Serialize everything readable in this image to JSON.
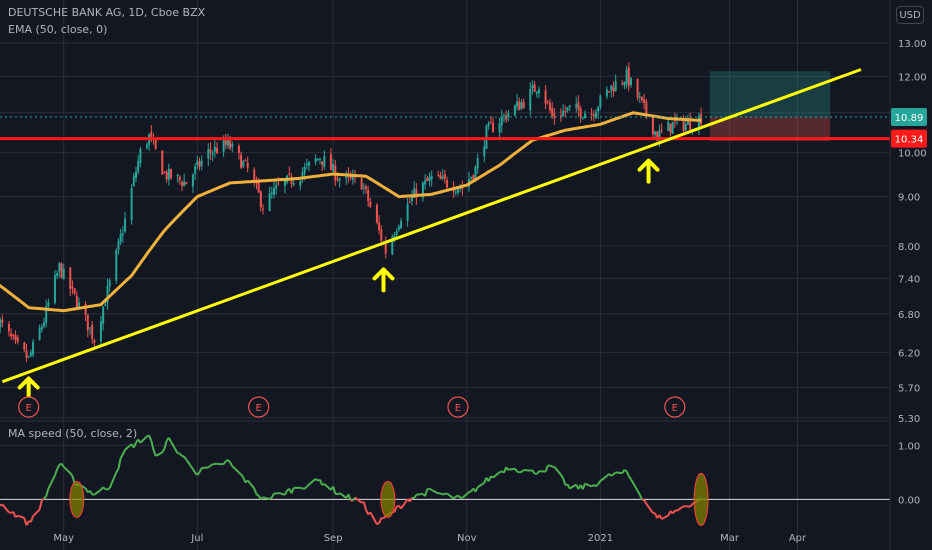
{
  "header": {
    "title": "DEUTSCHE BANK AG, 1D, Cboe BZX",
    "indicator": "EMA (50, close, 0)",
    "currency_button": "USD",
    "sub_indicator": "MA speed (50, close, 2)"
  },
  "colors": {
    "background": "#131722",
    "grid": "#2a2e39",
    "candle_up": "#26a69a",
    "candle_down": "#ef5350",
    "ema": "#f0b13c",
    "trendline": "#ffff00",
    "resistance": "#ff1a1a",
    "last_price_badge": "#26a69a",
    "level_badge": "#ff1a1a",
    "speed_up": "#4caf50",
    "speed_down": "#ef5350",
    "arrow": "#ffff00"
  },
  "chart_data": {
    "type": "candlestick",
    "price_axis": {
      "ticks": [
        "13.00",
        "12.00",
        "11.00",
        "10.00",
        "9.00",
        "8.00",
        "7.40",
        "6.80",
        "6.20",
        "5.70",
        "5.30"
      ],
      "scale": "log",
      "ylim": [
        5.1,
        13.8
      ]
    },
    "time_axis": {
      "ticks": [
        {
          "label": "May",
          "date": "2020-05-01"
        },
        {
          "label": "Jul",
          "date": "2020-07-01"
        },
        {
          "label": "Sep",
          "date": "2020-09-01"
        },
        {
          "label": "Nov",
          "date": "2020-11-01"
        },
        {
          "label": "2021",
          "date": "2021-01-01"
        },
        {
          "label": "Mar",
          "date": "2021-03-01"
        },
        {
          "label": "Apr",
          "date": "2021-04-01"
        }
      ],
      "xlim": [
        "2020-04-01",
        "2021-04-30"
      ]
    },
    "price_anchors": [
      {
        "date": "2020-04-01",
        "close": 6.7
      },
      {
        "date": "2020-04-09",
        "close": 6.3
      },
      {
        "date": "2020-04-15",
        "close": 6.1
      },
      {
        "date": "2020-04-22",
        "close": 6.7
      },
      {
        "date": "2020-04-29",
        "close": 7.6
      },
      {
        "date": "2020-05-07",
        "close": 7.0
      },
      {
        "date": "2020-05-15",
        "close": 6.4
      },
      {
        "date": "2020-05-22",
        "close": 7.3
      },
      {
        "date": "2020-05-29",
        "close": 8.5
      },
      {
        "date": "2020-06-05",
        "close": 10.0
      },
      {
        "date": "2020-06-09",
        "close": 10.4
      },
      {
        "date": "2020-06-16",
        "close": 9.5
      },
      {
        "date": "2020-06-26",
        "close": 9.3
      },
      {
        "date": "2020-07-06",
        "close": 10.0
      },
      {
        "date": "2020-07-15",
        "close": 10.2
      },
      {
        "date": "2020-07-24",
        "close": 9.6
      },
      {
        "date": "2020-07-31",
        "close": 8.8
      },
      {
        "date": "2020-08-07",
        "close": 9.2
      },
      {
        "date": "2020-08-17",
        "close": 9.5
      },
      {
        "date": "2020-08-26",
        "close": 9.9
      },
      {
        "date": "2020-09-04",
        "close": 9.4
      },
      {
        "date": "2020-09-14",
        "close": 9.3
      },
      {
        "date": "2020-09-21",
        "close": 8.4
      },
      {
        "date": "2020-09-25",
        "close": 7.9
      },
      {
        "date": "2020-10-02",
        "close": 8.6
      },
      {
        "date": "2020-10-09",
        "close": 9.1
      },
      {
        "date": "2020-10-16",
        "close": 9.4
      },
      {
        "date": "2020-10-23",
        "close": 9.3
      },
      {
        "date": "2020-10-30",
        "close": 9.2
      },
      {
        "date": "2020-11-05",
        "close": 9.6
      },
      {
        "date": "2020-11-10",
        "close": 10.5
      },
      {
        "date": "2020-11-20",
        "close": 11.0
      },
      {
        "date": "2020-11-27",
        "close": 11.3
      },
      {
        "date": "2020-12-04",
        "close": 11.8
      },
      {
        "date": "2020-12-10",
        "close": 10.9
      },
      {
        "date": "2020-12-18",
        "close": 11.1
      },
      {
        "date": "2020-12-28",
        "close": 11.0
      },
      {
        "date": "2021-01-06",
        "close": 11.7
      },
      {
        "date": "2021-01-13",
        "close": 12.0
      },
      {
        "date": "2021-01-20",
        "close": 11.2
      },
      {
        "date": "2021-01-27",
        "close": 10.4
      },
      {
        "date": "2021-02-03",
        "close": 10.7
      },
      {
        "date": "2021-02-10",
        "close": 10.7
      },
      {
        "date": "2021-02-16",
        "close": 10.89
      }
    ],
    "ema_anchors": [
      {
        "date": "2020-04-01",
        "value": 7.3
      },
      {
        "date": "2020-04-15",
        "value": 6.9
      },
      {
        "date": "2020-05-01",
        "value": 6.85
      },
      {
        "date": "2020-05-18",
        "value": 6.95
      },
      {
        "date": "2020-06-01",
        "value": 7.45
      },
      {
        "date": "2020-06-16",
        "value": 8.3
      },
      {
        "date": "2020-07-01",
        "value": 9.0
      },
      {
        "date": "2020-07-16",
        "value": 9.3
      },
      {
        "date": "2020-08-01",
        "value": 9.35
      },
      {
        "date": "2020-08-16",
        "value": 9.4
      },
      {
        "date": "2020-09-01",
        "value": 9.5
      },
      {
        "date": "2020-09-16",
        "value": 9.45
      },
      {
        "date": "2020-10-01",
        "value": 9.0
      },
      {
        "date": "2020-10-16",
        "value": 9.05
      },
      {
        "date": "2020-11-01",
        "value": 9.25
      },
      {
        "date": "2020-11-16",
        "value": 9.7
      },
      {
        "date": "2020-12-01",
        "value": 10.3
      },
      {
        "date": "2020-12-16",
        "value": 10.55
      },
      {
        "date": "2021-01-01",
        "value": 10.7
      },
      {
        "date": "2021-01-16",
        "value": 11.0
      },
      {
        "date": "2021-02-01",
        "value": 10.85
      },
      {
        "date": "2021-02-16",
        "value": 10.8
      }
    ],
    "last_price": "10.89",
    "horizontal_level": {
      "value": 10.34,
      "label": "10.34"
    },
    "trendline": {
      "start": {
        "date": "2020-04-03",
        "price": 5.78
      },
      "end": {
        "date": "2021-04-30",
        "price": 12.2
      }
    },
    "position_box": {
      "from": "2021-02-20",
      "to": "2021-04-16",
      "entry": 10.89,
      "target": 12.15,
      "stop": 10.28
    },
    "arrows": [
      {
        "date": "2020-04-15",
        "price": 5.7
      },
      {
        "date": "2020-09-24",
        "price": 7.4
      },
      {
        "date": "2021-01-23",
        "price": 9.6
      }
    ],
    "earnings_markers": [
      {
        "date": "2020-04-15",
        "label": "E"
      },
      {
        "date": "2020-07-29",
        "label": "E"
      },
      {
        "date": "2020-10-28",
        "label": "E"
      },
      {
        "date": "2021-02-04",
        "label": "E"
      }
    ],
    "ma_speed": {
      "axis_ticks": [
        "1.00",
        "0.00"
      ],
      "ylim": [
        -0.75,
        1.45
      ],
      "anchors": [
        {
          "date": "2020-04-01",
          "value": -0.05
        },
        {
          "date": "2020-04-15",
          "value": -0.45
        },
        {
          "date": "2020-04-22",
          "value": 0.0
        },
        {
          "date": "2020-04-29",
          "value": 0.65
        },
        {
          "date": "2020-05-07",
          "value": 0.3
        },
        {
          "date": "2020-05-15",
          "value": 0.1
        },
        {
          "date": "2020-05-22",
          "value": 0.25
        },
        {
          "date": "2020-05-29",
          "value": 0.9
        },
        {
          "date": "2020-06-09",
          "value": 1.2
        },
        {
          "date": "2020-06-12",
          "value": 0.75
        },
        {
          "date": "2020-06-18",
          "value": 1.1
        },
        {
          "date": "2020-06-23",
          "value": 0.85
        },
        {
          "date": "2020-07-01",
          "value": 0.5
        },
        {
          "date": "2020-07-15",
          "value": 0.7
        },
        {
          "date": "2020-07-31",
          "value": 0.0
        },
        {
          "date": "2020-08-15",
          "value": 0.2
        },
        {
          "date": "2020-08-26",
          "value": 0.35
        },
        {
          "date": "2020-09-04",
          "value": 0.1
        },
        {
          "date": "2020-09-14",
          "value": -0.05
        },
        {
          "date": "2020-09-21",
          "value": -0.45
        },
        {
          "date": "2020-09-28",
          "value": -0.25
        },
        {
          "date": "2020-10-05",
          "value": 0.0
        },
        {
          "date": "2020-10-15",
          "value": 0.15
        },
        {
          "date": "2020-10-30",
          "value": 0.0
        },
        {
          "date": "2020-11-10",
          "value": 0.35
        },
        {
          "date": "2020-11-20",
          "value": 0.6
        },
        {
          "date": "2020-12-01",
          "value": 0.5
        },
        {
          "date": "2020-12-10",
          "value": 0.6
        },
        {
          "date": "2020-12-18",
          "value": 0.2
        },
        {
          "date": "2020-12-28",
          "value": 0.25
        },
        {
          "date": "2021-01-06",
          "value": 0.45
        },
        {
          "date": "2021-01-13",
          "value": 0.5
        },
        {
          "date": "2021-01-20",
          "value": 0.05
        },
        {
          "date": "2021-01-27",
          "value": -0.35
        },
        {
          "date": "2021-02-05",
          "value": -0.2
        },
        {
          "date": "2021-02-16",
          "value": 0.0
        }
      ],
      "ellipses": [
        "2020-05-07",
        "2020-09-26",
        "2021-02-16"
      ]
    }
  }
}
